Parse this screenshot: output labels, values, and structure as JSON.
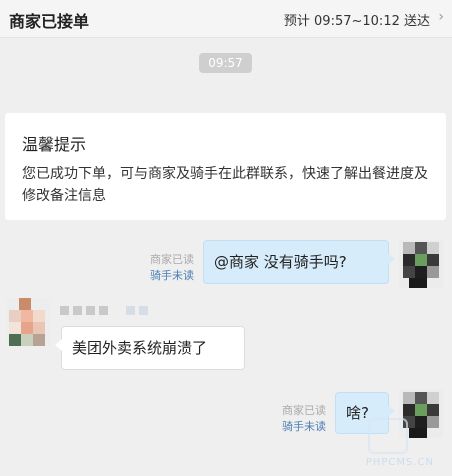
{
  "header": {
    "title": "商家已接单",
    "eta": "预计 09:57~10:12 送达",
    "chevron": "chevron-right-icon"
  },
  "chat": {
    "time": "09:57",
    "notice": {
      "title": "温馨提示",
      "body": "您已成功下单，可与商家及骑手在此群联系，快速了解出餐进度及修改备注信息"
    },
    "messages": [
      {
        "side": "me",
        "text": "@商家 没有骑手吗?",
        "merchant_status": "商家已读",
        "rider_status": "骑手未读"
      },
      {
        "side": "other",
        "text": "美团外卖系统崩溃了"
      },
      {
        "side": "me",
        "text": "啥?",
        "merchant_status": "商家已读",
        "rider_status": "骑手未读"
      }
    ]
  },
  "watermark": "PHPCMS.CN"
}
